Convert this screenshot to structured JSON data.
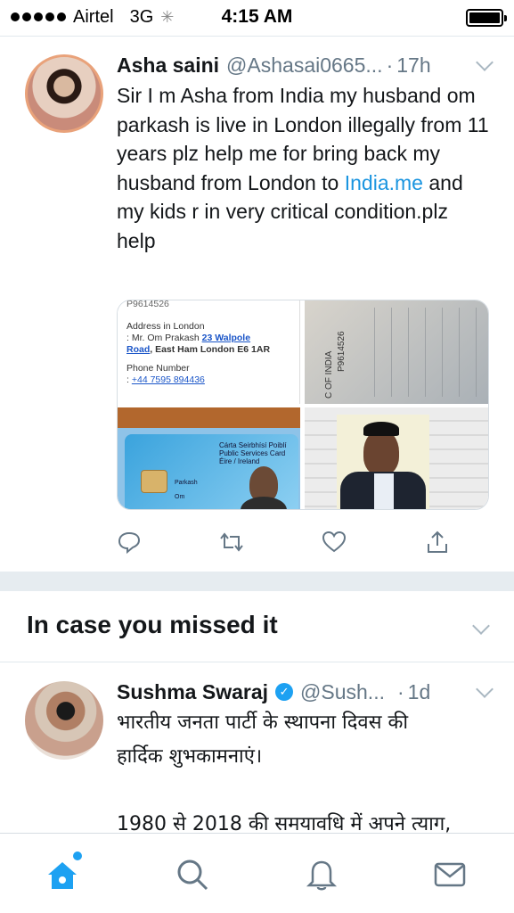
{
  "status_bar": {
    "carrier": "Airtel",
    "network": "3G",
    "time": "4:15 AM",
    "battery_level": 1.0
  },
  "tweet1": {
    "name": "Asha saini",
    "handle": "@Ashasai0665...",
    "dot": "·",
    "time": "17h",
    "text_before_link": "Sir I m Asha from India my husband om parkash is live in London illegally from 11 years plz help me for bring back my husband from London to ",
    "link": "India.me",
    "text_after_link": " and my kids r  in very critical condition.plz help",
    "media": {
      "doc_top_id": "P9614526",
      "address_label": "Address in London",
      "address_prefix": ":  Mr. Om Prakash ",
      "address_link": "23 Walpole",
      "address_line2_link": "Road",
      "address_line2_rest": ", East Ham London E6 1AR",
      "phone_label": "Phone Number",
      "phone_prefix": ":   ",
      "phone": "+44 7595 894436",
      "passport_country": "C OF INDIA",
      "passport_number": "P9614526",
      "card_title": "Cárta Seirbhísí Poiblí Public Services Card",
      "card_sub": "Éire / Ireland",
      "card_surname": "Parkash",
      "card_forename": "Om"
    }
  },
  "missed_section": {
    "title": "In case you missed it"
  },
  "tweet2": {
    "name": "Sushma Swaraj",
    "handle": "@Sush...",
    "dot": "·",
    "time": "1d",
    "line1": "भारतीय जनता पार्टी के स्थापना दिवस की",
    "line2": "हार्दिक शुभकामनाएं।",
    "line3": "",
    "line4": "1980 से 2018 की समयावधि में अपने त्याग,"
  },
  "colors": {
    "accent": "#1da1f2",
    "link": "#1b95e0",
    "muted": "#657786",
    "divider": "#e6ecf0"
  },
  "tabs": [
    {
      "icon": "home-icon",
      "active": true
    },
    {
      "icon": "search-icon",
      "active": false
    },
    {
      "icon": "notifications-icon",
      "active": false
    },
    {
      "icon": "messages-icon",
      "active": false
    }
  ]
}
